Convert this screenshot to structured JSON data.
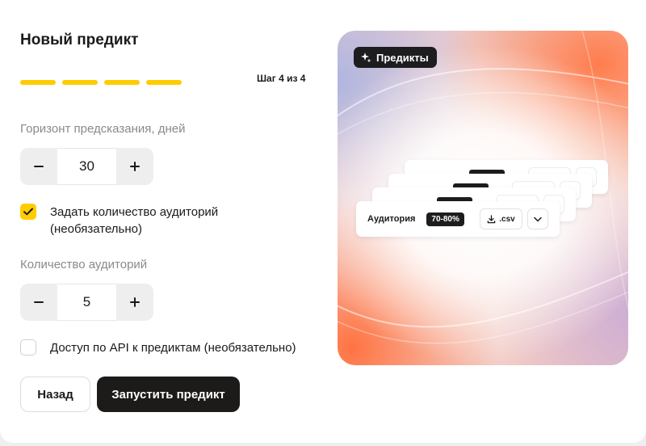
{
  "form": {
    "title": "Новый предикт",
    "step_label": "Шаг 4 из 4",
    "steps_total": 4,
    "steps_done": 4,
    "horizon": {
      "label": "Горизонт предсказания, дней",
      "value": "30"
    },
    "set_audiences": {
      "label": "Задать количество аудиторий (необязательно)",
      "checked": true
    },
    "audiences_count": {
      "label": "Количество аудиторий",
      "value": "5"
    },
    "api_access": {
      "label": "Доступ по API к предиктам (необязательно)",
      "checked": false
    },
    "back_label": "Назад",
    "run_label": "Запустить предикт"
  },
  "promo": {
    "badge": "Предикты",
    "card": {
      "label": "Аудитория",
      "range": "70-80%",
      "download_label": ".csv"
    }
  },
  "icons": {
    "minus": "minus-icon",
    "plus": "plus-icon",
    "check": "check-icon",
    "sparkle": "sparkle-icon",
    "download": "download-icon",
    "chevron": "chevron-down-icon"
  },
  "colors": {
    "accent": "#ffcc00",
    "primary_button": "#1c1b1a",
    "muted_text": "#8a8a8a"
  }
}
